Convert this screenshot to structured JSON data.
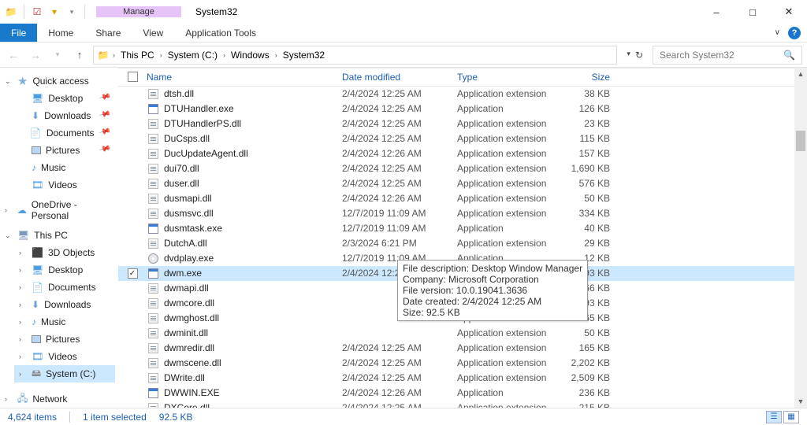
{
  "window": {
    "title": "System32",
    "manage_label": "Manage",
    "app_tools": "Application Tools"
  },
  "ribbon": {
    "file": "File",
    "home": "Home",
    "share": "Share",
    "view": "View"
  },
  "breadcrumb": {
    "pc": "This PC",
    "drive": "System (C:)",
    "win": "Windows",
    "sys": "System32"
  },
  "search": {
    "placeholder": "Search System32"
  },
  "navpane": {
    "quick": {
      "label": "Quick access",
      "items": [
        "Desktop",
        "Downloads",
        "Documents",
        "Pictures",
        "Music",
        "Videos"
      ]
    },
    "onedrive": "OneDrive - Personal",
    "thispc": {
      "label": "This PC",
      "items": [
        "3D Objects",
        "Desktop",
        "Documents",
        "Downloads",
        "Music",
        "Pictures",
        "Videos",
        "System (C:)"
      ]
    },
    "network": "Network"
  },
  "columns": {
    "name": "Name",
    "date": "Date modified",
    "type": "Type",
    "size": "Size"
  },
  "types": {
    "ext": "Application extension",
    "app": "Application"
  },
  "files": [
    {
      "n": "dtsh.dll",
      "d": "2/4/2024 12:25 AM",
      "t": "ext",
      "s": "38 KB",
      "k": "dll"
    },
    {
      "n": "DTUHandler.exe",
      "d": "2/4/2024 12:25 AM",
      "t": "app",
      "s": "126 KB",
      "k": "exe"
    },
    {
      "n": "DTUHandlerPS.dll",
      "d": "2/4/2024 12:25 AM",
      "t": "ext",
      "s": "23 KB",
      "k": "dll"
    },
    {
      "n": "DuCsps.dll",
      "d": "2/4/2024 12:25 AM",
      "t": "ext",
      "s": "115 KB",
      "k": "dll"
    },
    {
      "n": "DucUpdateAgent.dll",
      "d": "2/4/2024 12:26 AM",
      "t": "ext",
      "s": "157 KB",
      "k": "dll"
    },
    {
      "n": "dui70.dll",
      "d": "2/4/2024 12:25 AM",
      "t": "ext",
      "s": "1,690 KB",
      "k": "dll"
    },
    {
      "n": "duser.dll",
      "d": "2/4/2024 12:25 AM",
      "t": "ext",
      "s": "576 KB",
      "k": "dll"
    },
    {
      "n": "dusmapi.dll",
      "d": "2/4/2024 12:26 AM",
      "t": "ext",
      "s": "50 KB",
      "k": "dll"
    },
    {
      "n": "dusmsvc.dll",
      "d": "12/7/2019 11:09 AM",
      "t": "ext",
      "s": "334 KB",
      "k": "dll"
    },
    {
      "n": "dusmtask.exe",
      "d": "12/7/2019 11:09 AM",
      "t": "app",
      "s": "40 KB",
      "k": "exe"
    },
    {
      "n": "DutchA.dll",
      "d": "2/3/2024 6:21 PM",
      "t": "ext",
      "s": "29 KB",
      "k": "dll"
    },
    {
      "n": "dvdplay.exe",
      "d": "12/7/2019 11:09 AM",
      "t": "app",
      "s": "12 KB",
      "k": "dvd"
    },
    {
      "n": "dwm.exe",
      "d": "2/4/2024 12:25 AM",
      "t": "app",
      "s": "93 KB",
      "k": "exe",
      "sel": true
    },
    {
      "n": "dwmapi.dll",
      "d": "",
      "t": "ext",
      "s": "166 KB",
      "k": "dll"
    },
    {
      "n": "dwmcore.dll",
      "d": "",
      "t": "ext",
      "s": "3,493 KB",
      "k": "dll"
    },
    {
      "n": "dwmghost.dll",
      "d": "",
      "t": "ext",
      "s": "65 KB",
      "k": "dll"
    },
    {
      "n": "dwminit.dll",
      "d": "",
      "t": "ext",
      "s": "50 KB",
      "k": "dll"
    },
    {
      "n": "dwmredir.dll",
      "d": "2/4/2024 12:25 AM",
      "t": "ext",
      "s": "165 KB",
      "k": "dll"
    },
    {
      "n": "dwmscene.dll",
      "d": "2/4/2024 12:25 AM",
      "t": "ext",
      "s": "2,202 KB",
      "k": "dll"
    },
    {
      "n": "DWrite.dll",
      "d": "2/4/2024 12:25 AM",
      "t": "ext",
      "s": "2,509 KB",
      "k": "dll"
    },
    {
      "n": "DWWIN.EXE",
      "d": "2/4/2024 12:26 AM",
      "t": "app",
      "s": "236 KB",
      "k": "exe"
    },
    {
      "n": "DXCore.dll",
      "d": "2/4/2024 12:25 AM",
      "t": "ext",
      "s": "215 KB",
      "k": "dll"
    }
  ],
  "tooltip": {
    "l1": "File description: Desktop Window Manager",
    "l2": "Company: Microsoft Corporation",
    "l3": "File version: 10.0.19041.3636",
    "l4": "Date created: 2/4/2024 12:25 AM",
    "l5": "Size: 92.5 KB"
  },
  "status": {
    "count": "4,624 items",
    "sel": "1 item selected",
    "size": "92.5 KB"
  }
}
